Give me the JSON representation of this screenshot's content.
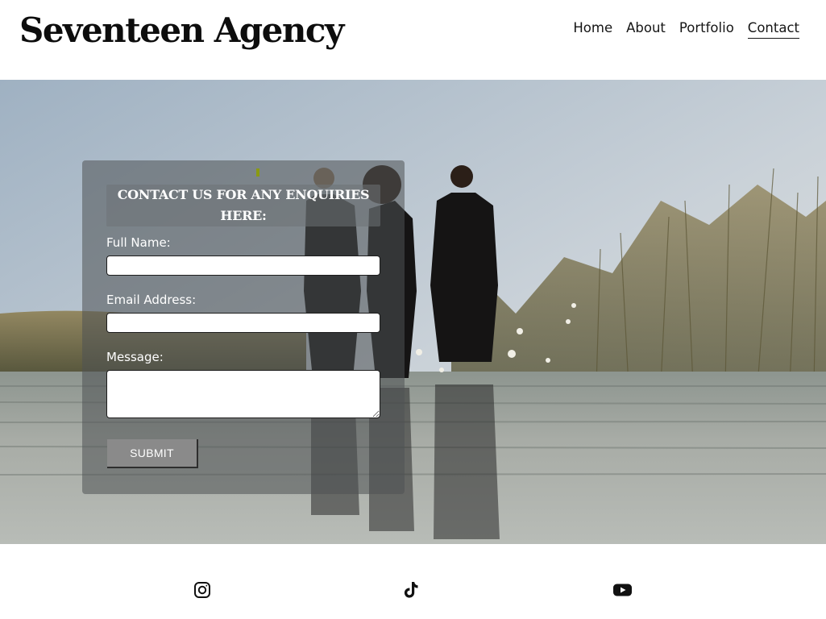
{
  "header": {
    "brand": "Seventeen Agency",
    "nav": [
      {
        "label": "Home",
        "active": false
      },
      {
        "label": "About",
        "active": false
      },
      {
        "label": "Portfolio",
        "active": false
      },
      {
        "label": "Contact",
        "active": true
      }
    ]
  },
  "contact_form": {
    "heading": "CONTACT US FOR ANY ENQUIRIES HERE:",
    "fields": [
      {
        "label": "Full Name:",
        "value": "",
        "placeholder": ""
      },
      {
        "label": "Email Address:",
        "value": "",
        "placeholder": ""
      },
      {
        "label": "Message:",
        "value": "",
        "placeholder": ""
      }
    ],
    "submit_label": "SUBMIT"
  },
  "footer": {
    "social": [
      "instagram-icon",
      "tiktok-icon",
      "youtube-icon"
    ]
  },
  "colors": {
    "text_dark": "#111111",
    "panel_overlay": "#4e5254",
    "submit_bg": "#8a8a8a",
    "active_underline": "#151515"
  }
}
